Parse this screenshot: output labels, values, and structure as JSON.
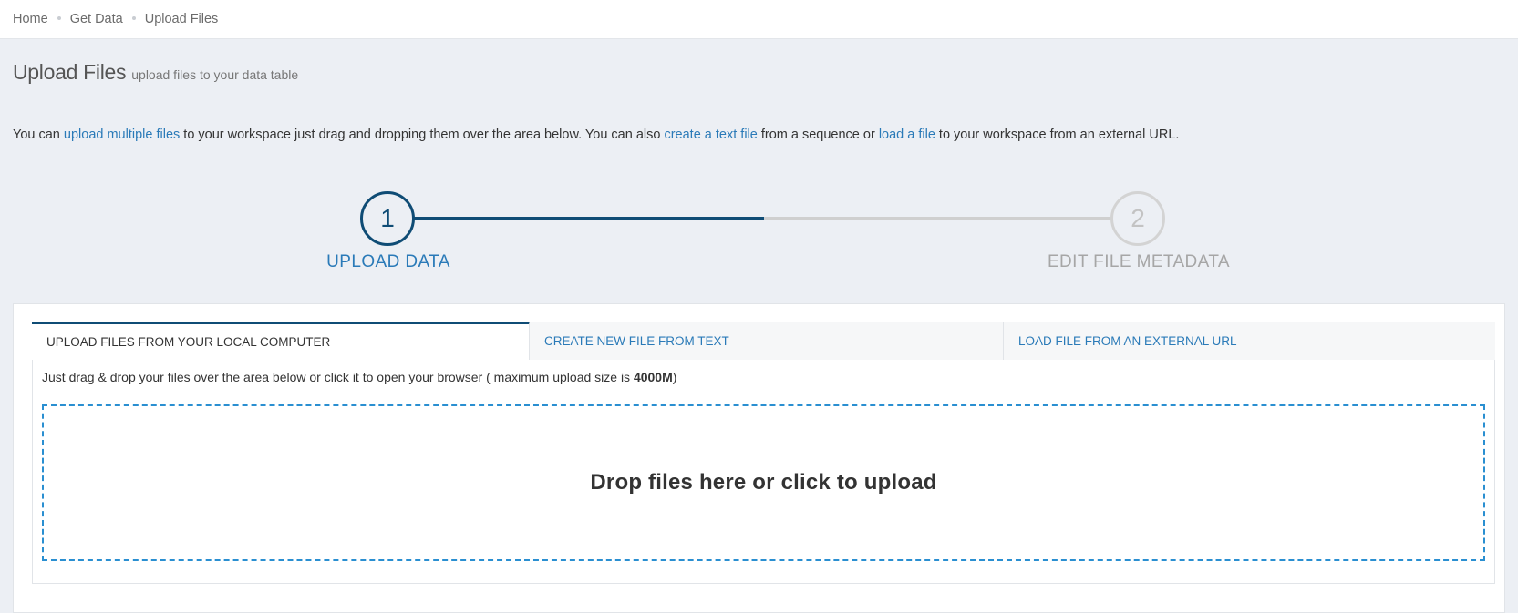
{
  "breadcrumb": {
    "items": [
      "Home",
      "Get Data",
      "Upload Files"
    ]
  },
  "page": {
    "title": "Upload Files",
    "subtitle": "upload files to your data table"
  },
  "intro": {
    "part1": "You can ",
    "link1": "upload multiple files",
    "part2": " to your workspace just drag and dropping them over the area below. You can also ",
    "link2": "create a text file",
    "part3": " from a sequence or ",
    "link3": "load a file",
    "part4": " to your workspace from an external URL."
  },
  "wizard": {
    "progress_fraction": 0.5,
    "steps": [
      {
        "number": "1",
        "label": "UPLOAD DATA",
        "state": "active"
      },
      {
        "number": "2",
        "label": "EDIT FILE METADATA",
        "state": "inactive"
      }
    ]
  },
  "tabs": [
    {
      "label": "UPLOAD FILES FROM YOUR LOCAL COMPUTER",
      "active": true
    },
    {
      "label": "CREATE NEW FILE FROM TEXT",
      "active": false
    },
    {
      "label": "LOAD FILE FROM AN EXTERNAL URL",
      "active": false
    }
  ],
  "upload": {
    "hint_prefix": "Just drag & drop your files over the area below or click it to open your browser ( maximum upload size is ",
    "max_size": "4000M",
    "hint_suffix": ")",
    "dropzone_text": "Drop files here or click to upload"
  },
  "colors": {
    "accent_dark": "#0f4c75",
    "link": "#2a7ab8",
    "dropzone_border": "#2a8fd1",
    "background": "#eceff4"
  }
}
